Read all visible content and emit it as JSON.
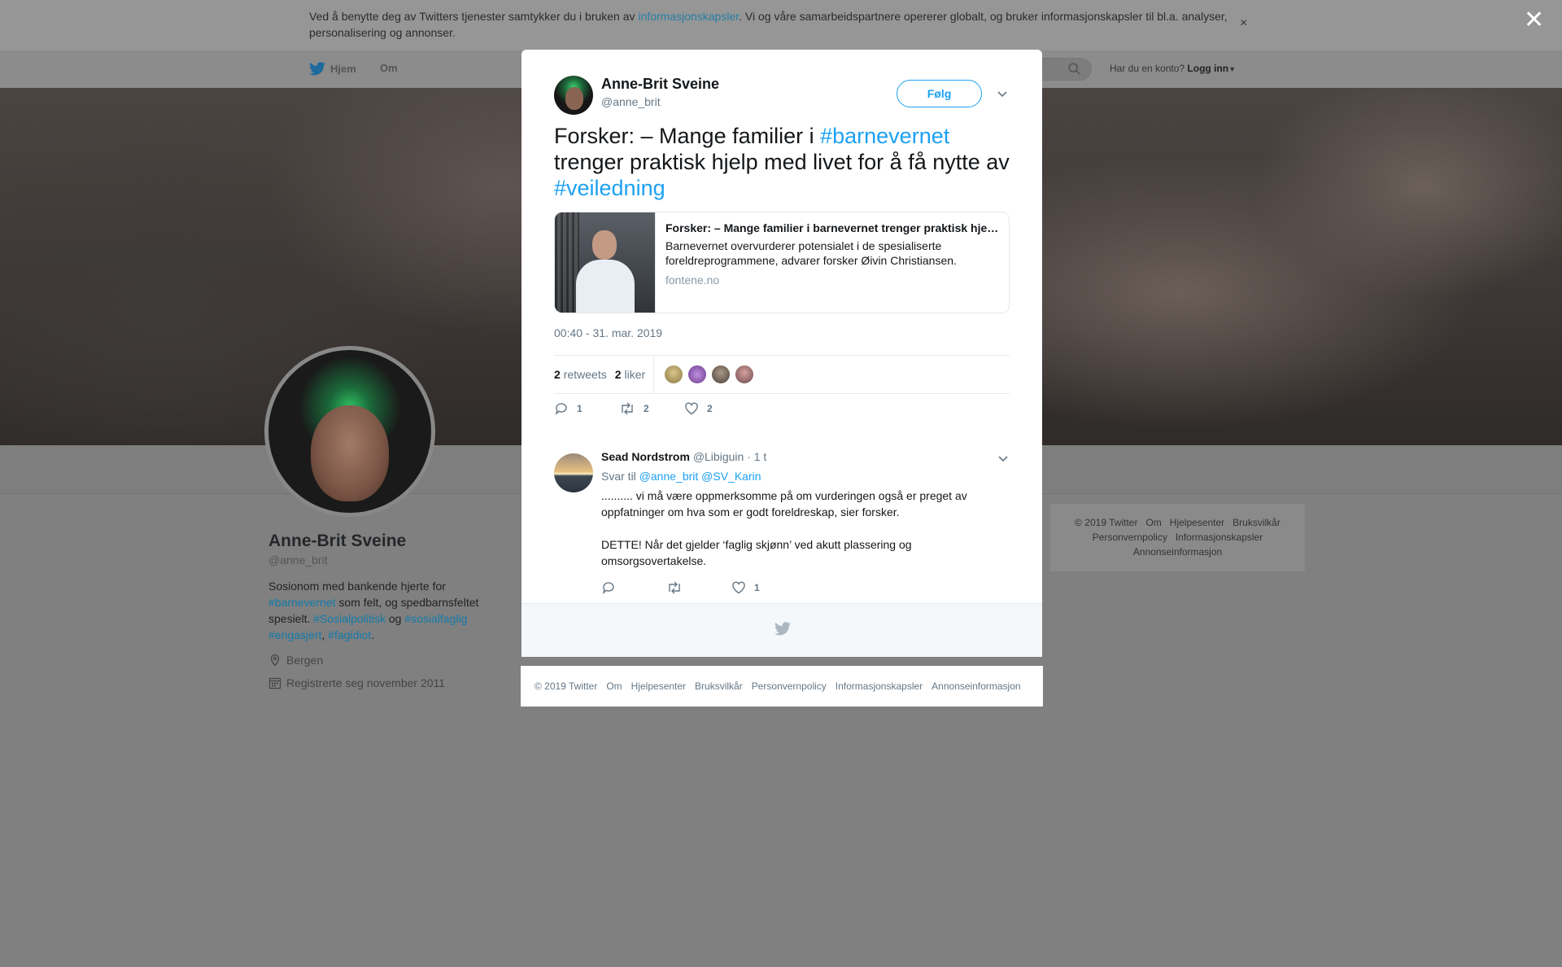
{
  "cookie": {
    "text_before": "Ved å benytte deg av Twitters tjenester samtykker du i bruken av ",
    "link": "informasjonskapsler",
    "text_after": ". Vi og våre samarbeidspartnere opererer globalt, og bruker informasjonskapsler til bl.a. analyser, personalisering og annonser.",
    "close": "×"
  },
  "overlay_close": "✕",
  "nav": {
    "home": "Hjem",
    "about": "Om",
    "login_prompt": "Har du en konto?",
    "login": "Logg inn"
  },
  "profile": {
    "name": "Anne-Brit Sveine",
    "handle": "@anne_brit",
    "bio": {
      "p1": "Sosionom med bankende hjerte for ",
      "t1": "#barnevernet",
      "p2": " som felt, og spedbarnsfeltet spesielt. ",
      "t2": "#Sosialpolitisk",
      "p3": " og ",
      "t3": "#sosialfaglig",
      "p4": " ",
      "t4": "#engasjert",
      "p5": ", ",
      "t5": "#fagidiot",
      "p6": "."
    },
    "location": "Bergen",
    "joined": "Registrerte seg november 2011"
  },
  "side_footer": {
    "items": [
      "© 2019 Twitter",
      "Om",
      "Hjelpesenter",
      "Bruksvilkår",
      "Personvernpolicy",
      "Informasjonskapsler",
      "Annonseinformasjon"
    ]
  },
  "tweet": {
    "author_name": "Anne-Brit Sveine",
    "author_handle": "@anne_brit",
    "follow_label": "Følg",
    "text": {
      "p1": "Forsker: – Mange familier i ",
      "h1": "#barnevernet",
      "p2": " trenger praktisk hjelp med livet for å få nytte av ",
      "h2": "#veiledning"
    },
    "card": {
      "title": "Forsker: – Mange familier i barnevernet trenger praktisk hjelp med livet for å få nytte av veiledning",
      "description": "Barnevernet overvurderer potensialet i de spesialiserte foreldreprogrammene, advarer forsker Øivin Christiansen.",
      "domain": "fontene.no"
    },
    "timestamp": "00:40 - 31. mar. 2019",
    "retweets_count": "2",
    "retweets_label": "retweets",
    "likes_count": "2",
    "likes_label": "liker",
    "likers_colors": [
      "#b9a36b",
      "#8e5fb4",
      "#7a6a5a",
      "#b06a6a"
    ],
    "actions": {
      "reply": "1",
      "retweet": "2",
      "like": "2"
    }
  },
  "reply": {
    "name": "Sead Nordstrom",
    "handle": "@Libiguin",
    "time": "· 1 t",
    "reply_to_label": "Svar til",
    "reply_to_1": "@anne_brit",
    "reply_to_2": "@SV_Karin",
    "text": ".......... vi må være oppmerksomme på om vurderingen også er preget av oppfatninger om hva som er godt foreldreskap, sier forsker.\n\nDETTE!  Når det gjelder ‘faglig skjønn’ ved akutt plassering og omsorgsovertakelse.",
    "actions": {
      "reply": "",
      "retweet": "",
      "like": "1"
    }
  },
  "modal_footer": {
    "items": [
      "© 2019 Twitter",
      "Om",
      "Hjelpesenter",
      "Bruksvilkår",
      "Personvernpolicy",
      "Informasjonskapsler",
      "Annonseinformasjon"
    ]
  },
  "colors": {
    "accent": "#1da1f2",
    "overlay": "#808080",
    "text": "#14171a",
    "muted": "#657786"
  }
}
